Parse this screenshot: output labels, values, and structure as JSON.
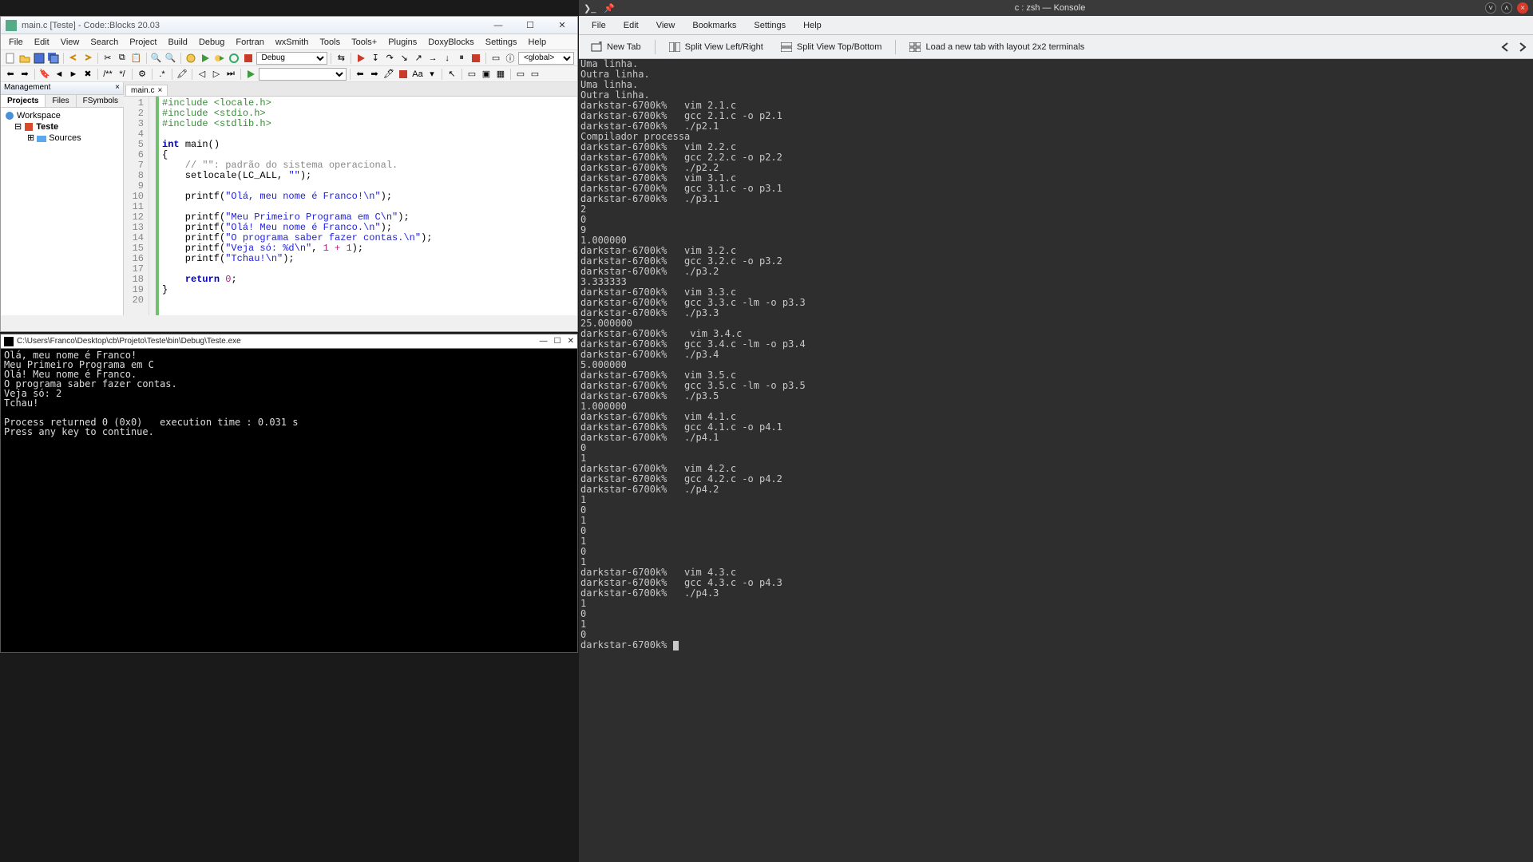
{
  "codeblocks": {
    "title": "main.c [Teste] - Code::Blocks 20.03",
    "menus": [
      "File",
      "Edit",
      "View",
      "Search",
      "Project",
      "Build",
      "Debug",
      "Fortran",
      "wxSmith",
      "Tools",
      "Tools+",
      "Plugins",
      "DoxyBlocks",
      "Settings",
      "Help"
    ],
    "build_target": "Debug",
    "scope_select": "<global>",
    "mgmt": {
      "title": "Management",
      "tabs": [
        "Projects",
        "Files",
        "FSymbols"
      ],
      "active_tab": "Projects",
      "tree": {
        "root": "Workspace",
        "project": "Teste",
        "folder": "Sources"
      }
    },
    "editor_tab": "main.c",
    "code_lines": [
      {
        "n": 1,
        "type": "pre",
        "text": "#include <locale.h>"
      },
      {
        "n": 2,
        "type": "pre",
        "text": "#include <stdio.h>"
      },
      {
        "n": 3,
        "type": "pre",
        "text": "#include <stdlib.h>"
      },
      {
        "n": 4,
        "type": "blank",
        "text": ""
      },
      {
        "n": 5,
        "type": "fn",
        "kw": "int",
        "name": "main",
        "rest": "()"
      },
      {
        "n": 6,
        "type": "brace",
        "text": "{"
      },
      {
        "n": 7,
        "type": "cmt",
        "text": "    // \"\": padrão do sistema operacional."
      },
      {
        "n": 8,
        "type": "call",
        "text": "    setlocale(LC_ALL, \"\");"
      },
      {
        "n": 9,
        "type": "blank",
        "text": ""
      },
      {
        "n": 10,
        "type": "printf",
        "str": "Olá, meu nome é Franco!\\n"
      },
      {
        "n": 11,
        "type": "blank",
        "text": ""
      },
      {
        "n": 12,
        "type": "printf",
        "str": "Meu Primeiro Programa em C\\n"
      },
      {
        "n": 13,
        "type": "printf",
        "str": "Olá! Meu nome é Franco.\\n"
      },
      {
        "n": 14,
        "type": "printf",
        "str": "O programa saber fazer contas.\\n"
      },
      {
        "n": 15,
        "type": "printfexpr",
        "str": "Veja só: %d\\n",
        "expr": "1 + 1"
      },
      {
        "n": 16,
        "type": "printf",
        "str": "Tchau!\\n"
      },
      {
        "n": 17,
        "type": "blank",
        "text": ""
      },
      {
        "n": 18,
        "type": "return",
        "text": "    return 0;"
      },
      {
        "n": 19,
        "type": "brace",
        "text": "}"
      },
      {
        "n": 20,
        "type": "blank",
        "text": ""
      }
    ]
  },
  "cmdwin": {
    "title": "C:\\Users\\Franco\\Desktop\\cb\\Projeto\\Teste\\bin\\Debug\\Teste.exe",
    "lines": [
      "Olá, meu nome é Franco!",
      "Meu Primeiro Programa em C",
      "Olá! Meu nome é Franco.",
      "O programa saber fazer contas.",
      "Veja só: 2",
      "Tchau!",
      "",
      "Process returned 0 (0x0)   execution time : 0.031 s",
      "Press any key to continue."
    ]
  },
  "konsole": {
    "title": "c : zsh — Konsole",
    "menus": [
      "File",
      "Edit",
      "View",
      "Bookmarks",
      "Settings",
      "Help"
    ],
    "toolbar": {
      "new_tab": "New Tab",
      "split_lr": "Split View Left/Right",
      "split_tb": "Split View Top/Bottom",
      "load_tab": "Load a new tab with layout 2x2 terminals"
    },
    "prompt": "darkstar-6700k%",
    "lines": [
      "Uma linha.",
      "Outra linha.",
      "Uma linha.",
      "Outra linha.",
      "darkstar-6700k%   vim 2.1.c",
      "darkstar-6700k%   gcc 2.1.c -o p2.1",
      "darkstar-6700k%   ./p2.1",
      "Compilador processa",
      "darkstar-6700k%   vim 2.2.c",
      "darkstar-6700k%   gcc 2.2.c -o p2.2",
      "darkstar-6700k%   ./p2.2",
      "darkstar-6700k%   vim 3.1.c",
      "darkstar-6700k%   gcc 3.1.c -o p3.1",
      "darkstar-6700k%   ./p3.1",
      "2",
      "0",
      "9",
      "1.000000",
      "darkstar-6700k%   vim 3.2.c",
      "darkstar-6700k%   gcc 3.2.c -o p3.2",
      "darkstar-6700k%   ./p3.2",
      "3.333333",
      "darkstar-6700k%   vim 3.3.c",
      "darkstar-6700k%   gcc 3.3.c -lm -o p3.3",
      "darkstar-6700k%   ./p3.3",
      "25.000000",
      "darkstar-6700k%    vim 3.4.c",
      "darkstar-6700k%   gcc 3.4.c -lm -o p3.4",
      "darkstar-6700k%   ./p3.4",
      "5.000000",
      "darkstar-6700k%   vim 3.5.c",
      "darkstar-6700k%   gcc 3.5.c -lm -o p3.5",
      "darkstar-6700k%   ./p3.5",
      "1.000000",
      "darkstar-6700k%   vim 4.1.c",
      "darkstar-6700k%   gcc 4.1.c -o p4.1",
      "darkstar-6700k%   ./p4.1",
      "0",
      "1",
      "darkstar-6700k%   vim 4.2.c",
      "darkstar-6700k%   gcc 4.2.c -o p4.2",
      "darkstar-6700k%   ./p4.2",
      "1",
      "0",
      "1",
      "0",
      "1",
      "0",
      "1",
      "darkstar-6700k%   vim 4.3.c",
      "darkstar-6700k%   gcc 4.3.c -o p4.3",
      "darkstar-6700k%   ./p4.3",
      "1",
      "0",
      "1",
      "0"
    ]
  }
}
